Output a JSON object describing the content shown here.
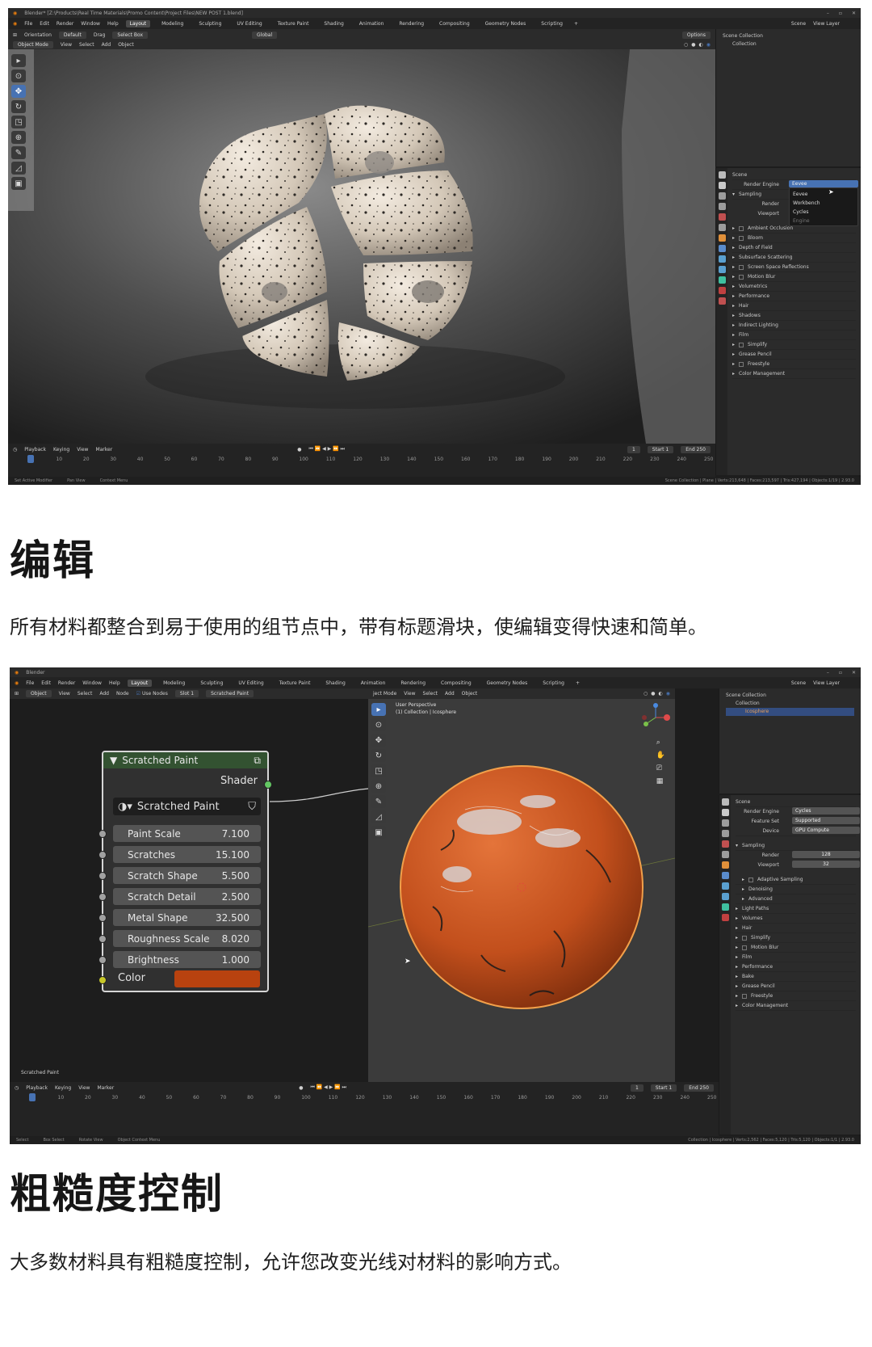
{
  "screenshot1": {
    "title_path": "Blender* [Z:\\Products\\Real Time Materials\\Promo Content\\Project Files\\NEW POST 1.blend]",
    "menu": [
      "File",
      "Edit",
      "Render",
      "Window",
      "Help"
    ],
    "workspace_tabs": [
      "Layout",
      "Modeling",
      "Sculpting",
      "UV Editing",
      "Texture Paint",
      "Shading",
      "Animation",
      "Rendering",
      "Compositing",
      "Geometry Nodes",
      "Scripting"
    ],
    "active_tab": "Layout",
    "scene_label": "Scene",
    "view_layer_label": "View Layer",
    "tool_header": {
      "orientation": "Orientation",
      "default": "Default",
      "drag": "Drag",
      "select_box": "Select Box",
      "transform": "Global",
      "options": "Options"
    },
    "viewport_header": [
      "Object Mode",
      "View",
      "Select",
      "Add",
      "Object"
    ],
    "outliner": {
      "scene_collection": "Scene Collection",
      "collection": "Collection"
    },
    "properties": {
      "scene": "Scene",
      "render_engine_label": "Render Engine",
      "render_engine_value": "Eevee",
      "dropdown_options": [
        "Eevee",
        "Workbench",
        "Cycles"
      ],
      "dropdown_footer": "Engine",
      "sampling": "Sampling",
      "render_label": "Render",
      "viewport_label": "Viewport",
      "sections": [
        "Ambient Occlusion",
        "Bloom",
        "Depth of Field",
        "Subsurface Scattering",
        "Screen Space Reflections",
        "Motion Blur",
        "Volumetrics",
        "Performance",
        "Hair",
        "Shadows",
        "Indirect Lighting",
        "Film",
        "Simplify",
        "Grease Pencil",
        "Freestyle",
        "Color Management"
      ]
    },
    "timeline": {
      "menus": [
        "Playback",
        "Keying",
        "View",
        "Marker"
      ],
      "current_frame": "1",
      "start_label": "Start",
      "start": "1",
      "end_label": "End",
      "end": "250",
      "ticks": [
        "0",
        "10",
        "20",
        "30",
        "40",
        "50",
        "60",
        "70",
        "80",
        "90",
        "100",
        "110",
        "120",
        "130",
        "140",
        "150",
        "160",
        "170",
        "180",
        "190",
        "200",
        "210",
        "220",
        "230",
        "240",
        "250"
      ]
    },
    "status": {
      "left": "Set Active Modifier",
      "middle": "Pan View",
      "right_hint": "Context Menu",
      "stats": "Scene Collection | Plane | Verts:213,648 | Faces:213,597 | Tris:427,194 | Objects:1/19 | 2.93.0"
    }
  },
  "section1": {
    "heading": "编辑",
    "text": "所有材料都整合到易于使用的组节点中，带有标题滑块，使编辑变得快速和简单。"
  },
  "screenshot2": {
    "title": "Blender",
    "menu": [
      "File",
      "Edit",
      "Render",
      "Window",
      "Help"
    ],
    "workspace_tabs": [
      "Layout",
      "Modeling",
      "Sculpting",
      "UV Editing",
      "Texture Paint",
      "Shading",
      "Animation",
      "Rendering",
      "Compositing",
      "Geometry Nodes",
      "Scripting"
    ],
    "active_tab": "Layout",
    "scene_label": "Scene",
    "view_layer_label": "View Layer",
    "node_header": [
      "Object",
      "View",
      "Select",
      "Add",
      "Node",
      "Use Nodes",
      "Slot 1",
      "Scratched Paint"
    ],
    "viewport_header": [
      "ject Mode",
      "View",
      "Select",
      "Add",
      "Object"
    ],
    "viewport_overlay_line1": "User Perspective",
    "viewport_overlay_line2": "(1) Collection | Icosphere",
    "node": {
      "title": "Scratched Paint",
      "output": "Shader",
      "group_name": "Scratched Paint",
      "inputs": [
        {
          "label": "Paint Scale",
          "value": "7.100"
        },
        {
          "label": "Scratches",
          "value": "15.100"
        },
        {
          "label": "Scratch Shape",
          "value": "5.500"
        },
        {
          "label": "Scratch Detail",
          "value": "2.500"
        },
        {
          "label": "Metal Shape",
          "value": "32.500"
        },
        {
          "label": "Roughness Scale",
          "value": "8.020"
        },
        {
          "label": "Brightness",
          "value": "1.000"
        }
      ],
      "color_label": "Color",
      "color_value": "#b8420f"
    },
    "editor_label": "Scratched Paint",
    "outliner": {
      "scene_collection": "Scene Collection",
      "collection": "Collection",
      "object": "Icosphere"
    },
    "properties": {
      "scene": "Scene",
      "render_engine_label": "Render Engine",
      "render_engine_value": "Cycles",
      "feature_set_label": "Feature Set",
      "feature_set_value": "Supported",
      "device_label": "Device",
      "device_value": "GPU Compute",
      "sampling": "Sampling",
      "render_label": "Render",
      "render_value": "128",
      "viewport_label": "Viewport",
      "viewport_value": "32",
      "sub_sections": [
        "Adaptive Sampling",
        "Denoising",
        "Advanced"
      ],
      "sections": [
        "Light Paths",
        "Volumes",
        "Hair",
        "Simplify",
        "Motion Blur",
        "Film",
        "Performance",
        "Bake",
        "Grease Pencil",
        "Freestyle",
        "Color Management"
      ]
    },
    "timeline": {
      "menus": [
        "Playback",
        "Keying",
        "View",
        "Marker"
      ],
      "current_frame": "1",
      "start_label": "Start",
      "start": "1",
      "end_label": "End",
      "end": "250",
      "ticks": [
        "0",
        "10",
        "20",
        "30",
        "40",
        "50",
        "60",
        "70",
        "80",
        "90",
        "100",
        "110",
        "120",
        "130",
        "140",
        "150",
        "160",
        "170",
        "180",
        "190",
        "200",
        "210",
        "220",
        "230",
        "240",
        "250"
      ]
    },
    "status": {
      "select": "Select",
      "box_select": "Box Select",
      "rotate": "Rotate View",
      "context": "Object Context Menu",
      "stats": "Collection | Icosphere | Verts:2,562 | Faces:5,120 | Tris:5,120 | Objects:1/1 | 2.93.0"
    }
  },
  "section2": {
    "heading": "粗糙度控制",
    "text": "大多数材料具有粗糙度控制，允许您改变光线对材料的影响方式。"
  },
  "colors": {
    "accent_blue": "#4772b3",
    "node_header_green": "#335231",
    "socket_green": "#63c763",
    "socket_yellow": "#c7c729",
    "sphere_orange": "#c9521e",
    "stone": "#d7cbbb"
  }
}
